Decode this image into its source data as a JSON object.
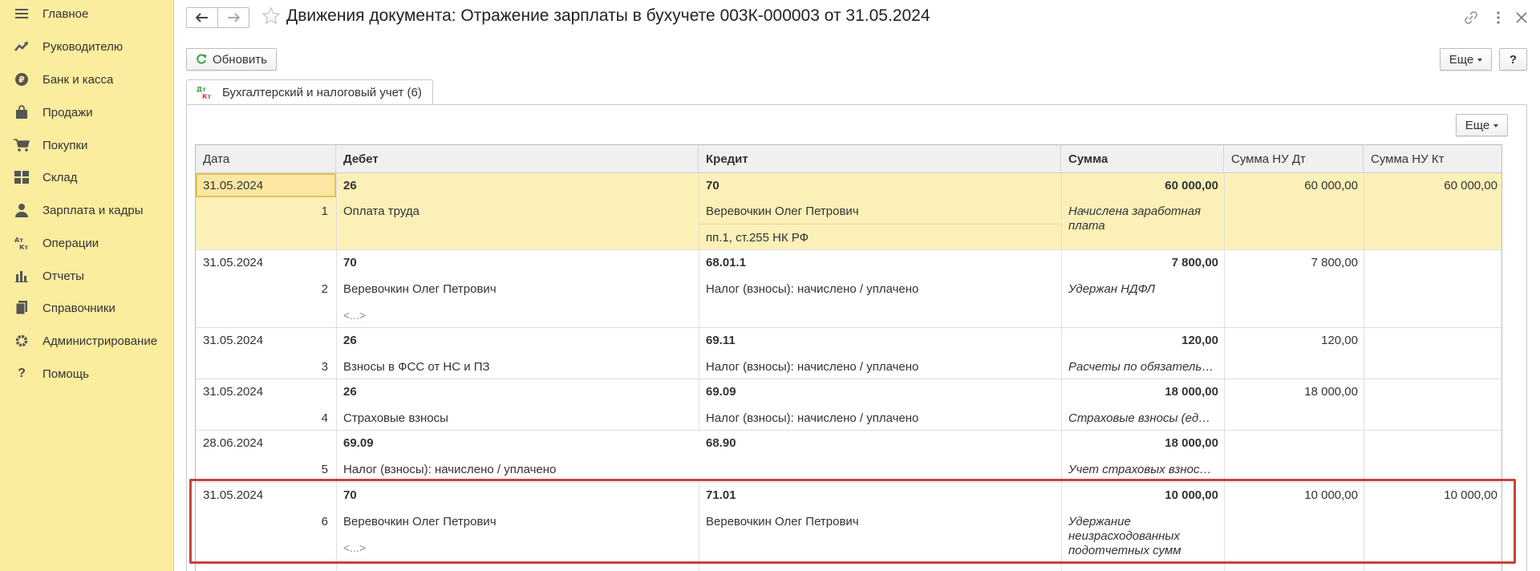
{
  "sidebar": {
    "items": [
      {
        "label": "Главное",
        "icon": "menu-icon"
      },
      {
        "label": "Руководителю",
        "icon": "trend-icon"
      },
      {
        "label": "Банк и касса",
        "icon": "ruble-icon"
      },
      {
        "label": "Продажи",
        "icon": "bag-icon"
      },
      {
        "label": "Покупки",
        "icon": "cart-icon"
      },
      {
        "label": "Склад",
        "icon": "grid-icon"
      },
      {
        "label": "Зарплата и кадры",
        "icon": "person-icon"
      },
      {
        "label": "Операции",
        "icon": "dt-kt-icon"
      },
      {
        "label": "Отчеты",
        "icon": "bar-chart-icon"
      },
      {
        "label": "Справочники",
        "icon": "books-icon"
      },
      {
        "label": "Администрирование",
        "icon": "gear-icon"
      },
      {
        "label": "Помощь",
        "icon": "question-icon"
      }
    ]
  },
  "header": {
    "title": "Движения документа: Отражение зарплаты в бухучете 003К-000003 от 31.05.2024"
  },
  "toolbar": {
    "refresh_label": "Обновить",
    "more_label": "Еще",
    "help_label": "?",
    "table_more_label": "Еще"
  },
  "tab": {
    "label": "Бухгалтерский и налоговый учет (6)",
    "icon_top": "Дт",
    "icon_bottom": "Кт"
  },
  "table": {
    "columns": [
      "Дата",
      "Дебет",
      "Кредит",
      "Сумма",
      "Сумма НУ Дт",
      "Сумма НУ Кт"
    ],
    "rows": [
      {
        "date": "31.05.2024",
        "n": "1",
        "debit": "26",
        "debit_sub": "Оплата труда",
        "debit_sub2": "",
        "credit": "70",
        "credit_sub": "Веревочкин Олег Петрович",
        "credit_sub2": "пп.1, ст.255 НК РФ",
        "sum": "60 000,00",
        "content": "Начислена заработная плата",
        "nu_dt": "60 000,00",
        "nu_kt": "60 000,00"
      },
      {
        "date": "31.05.2024",
        "n": "2",
        "debit": "70",
        "debit_sub": "Веревочкин Олег Петрович",
        "debit_sub2": "<...>",
        "credit": "68.01.1",
        "credit_sub": "Налог (взносы): начислено / уплачено",
        "credit_sub2": "",
        "sum": "7 800,00",
        "content": "Удержан НДФЛ",
        "nu_dt": "7 800,00",
        "nu_kt": ""
      },
      {
        "date": "31.05.2024",
        "n": "3",
        "debit": "26",
        "debit_sub": "Взносы в ФСС от НС и ПЗ",
        "debit_sub2": "",
        "credit": "69.11",
        "credit_sub": "Налог (взносы): начислено / уплачено",
        "credit_sub2": "",
        "sum": "120,00",
        "content": "Расчеты по обязатель…",
        "nu_dt": "120,00",
        "nu_kt": ""
      },
      {
        "date": "31.05.2024",
        "n": "4",
        "debit": "26",
        "debit_sub": "Страховые взносы",
        "debit_sub2": "",
        "credit": "69.09",
        "credit_sub": "Налог (взносы): начислено / уплачено",
        "credit_sub2": "",
        "sum": "18 000,00",
        "content": "Страховые взносы (ед…",
        "nu_dt": "18 000,00",
        "nu_kt": ""
      },
      {
        "date": "28.06.2024",
        "n": "5",
        "debit": "69.09",
        "debit_sub": "Налог (взносы): начислено / уплачено",
        "debit_sub2": "",
        "credit": "68.90",
        "credit_sub": "",
        "credit_sub2": "",
        "sum": "18 000,00",
        "content": "Учет страховых взнос…",
        "nu_dt": "",
        "nu_kt": ""
      },
      {
        "date": "31.05.2024",
        "n": "6",
        "debit": "70",
        "debit_sub": "Веревочкин Олег Петрович",
        "debit_sub2": "<...>",
        "credit": "71.01",
        "credit_sub": "Веревочкин Олег Петрович",
        "credit_sub2": "",
        "sum": "10 000,00",
        "content": "Удержание неизрасходованных подотчетных сумм",
        "nu_dt": "10 000,00",
        "nu_kt": "10 000,00"
      }
    ]
  },
  "colors": {
    "sidebar_bg": "#fbed9e",
    "selected_row": "#fbf0b8",
    "highlight_border": "#c9423a",
    "refresh_icon": "#3aa14a"
  }
}
